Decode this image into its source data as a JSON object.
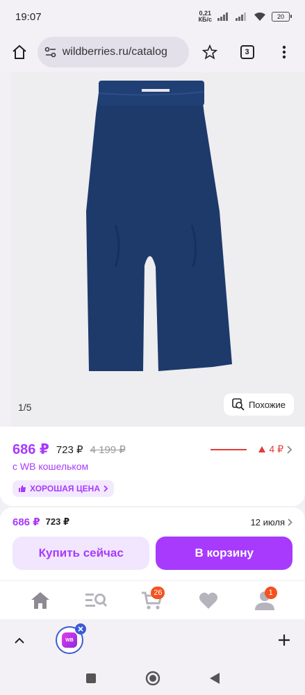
{
  "status_bar": {
    "time": "19:07",
    "net_speed_value": "0,21",
    "net_speed_unit": "КБ/с",
    "battery": "20"
  },
  "browser": {
    "url": "wildberries.ru/catalog",
    "tab_count": "3"
  },
  "gallery": {
    "counter": "1/5",
    "similar_label": "Похожие"
  },
  "price_card": {
    "price": "686 ₽",
    "price_without_wallet": "723 ₽",
    "old_price": "4 199 ₽",
    "price_change": "4 ₽",
    "wallet_note": "с WB кошельком",
    "badge": "ХОРОШАЯ ЦЕНА"
  },
  "buy_panel": {
    "price": "686 ₽",
    "price_without_wallet": "723 ₽",
    "delivery_date": "12 июля",
    "buy_now_label": "Купить сейчас",
    "add_to_cart_label": "В корзину"
  },
  "bottom_nav": {
    "cart_badge": "26",
    "profile_badge": "1"
  },
  "tab_strip": {
    "wb_logo": "WB"
  },
  "colors": {
    "accent": "#a73afd",
    "accent_light": "#f1e6fe",
    "price_up": "#e53935",
    "badge": "#f4511e",
    "pants": "#1d3a6b"
  }
}
